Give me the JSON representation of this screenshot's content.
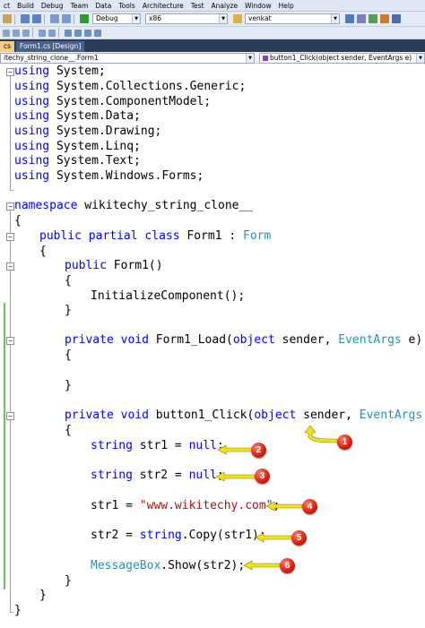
{
  "menu": [
    "ct",
    "Build",
    "Debug",
    "Team",
    "Data",
    "Tools",
    "Architecture",
    "Test",
    "Analyze",
    "Window",
    "Help"
  ],
  "toolbar": {
    "config": "Debug",
    "platform": "x86",
    "find_text": "venkat"
  },
  "tabs": [
    {
      "label": "cs",
      "active": true
    },
    {
      "label": "Form1.cs [Design]",
      "active": false
    }
  ],
  "nav": {
    "type_combo": "itechy_string_clone__.Form1",
    "member_combo": "button1_Click(object sender, EventArgs e)"
  },
  "code": {
    "using_kw": "using",
    "usings": [
      "System;",
      "System.Collections.Generic;",
      "System.ComponentModel;",
      "System.Data;",
      "System.Drawing;",
      "System.Linq;",
      "System.Text;",
      "System.Windows.Forms;"
    ],
    "namespace_kw": "namespace",
    "namespace_name": " wikitechy_string_clone__",
    "open_brace": "{",
    "close_brace": "}",
    "public_kw": "public",
    "partial_kw": "partial",
    "class_kw": "class",
    "class_name": " Form1 : ",
    "form_type": "Form",
    "ctor": " Form1()",
    "init_call": "InitializeComponent();",
    "private_kw": "private",
    "void_kw": "void",
    "load_name": " Form1_Load(",
    "object_kw": "object",
    "sender_sep": " sender, ",
    "eventargs_type": "EventArgs",
    "e_close": " e)",
    "click_name": " button1_Click(",
    "string_kw": "string",
    "str1_decl": " str1 = ",
    "str2_decl": " str2 = ",
    "null_kw": "null",
    "semicolon": ";",
    "str1_assign": "str1 = ",
    "url_literal": "\"www.wikitechy.com\"",
    "str2_assign": "str2 = ",
    "copy_call": ".Copy(str1);",
    "messagebox_type": "MessageBox",
    "show_call": ".Show(str2);"
  },
  "markers": [
    "1",
    "2",
    "3",
    "4",
    "5",
    "6"
  ],
  "colors": {
    "keyword": "#0000ff",
    "type": "#2b91af",
    "string_literal": "#a31515",
    "marker": "#d91b0b",
    "arrow": "#f1e21a"
  }
}
